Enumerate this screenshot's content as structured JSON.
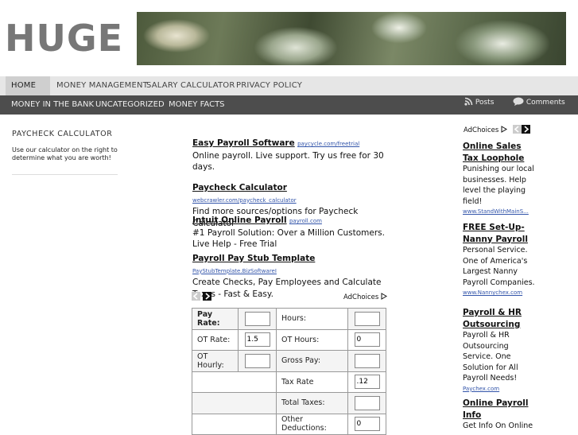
{
  "header": {
    "logo": "HUGE"
  },
  "nav_primary": [
    {
      "label": "HOME"
    },
    {
      "label": "MONEY MANAGEMENT"
    },
    {
      "label": "SALARY CALCULATOR"
    },
    {
      "label": "PRIVACY POLICY"
    }
  ],
  "nav_secondary": [
    {
      "label": "MONEY IN THE BANK"
    },
    {
      "label": "UNCATEGORIZED"
    },
    {
      "label": "MONEY FACTS"
    }
  ],
  "feeds": {
    "posts": "Posts",
    "comments": "Comments"
  },
  "sidebar": {
    "title": "PAYCHECK CALCULATOR",
    "text": "Use our calculator on the right to determine what you are worth!"
  },
  "adchoices_label": "AdChoices",
  "main_ads": [
    {
      "title": "Easy Payroll Software",
      "url": "paycycle.com/freetrial",
      "text": "Online payroll. Live support. Try us free for 30 days."
    },
    {
      "title": "Paycheck Calculator",
      "url": "webcrawler.com/paycheck_calculator",
      "text": "Find more sources/options for Paycheck Calculator"
    },
    {
      "title": "Intuit Online Payroll",
      "url": "payroll.com",
      "text": "#1 Payroll Solution: Over a Million Customers. Live Help - Free Trial"
    },
    {
      "title": "Payroll Pay Stub Template",
      "url": "PayStubTemplate.BizSoftwareI",
      "text": "Create Checks, Pay Employees and Calculate Taxes - Fast & Easy."
    }
  ],
  "calculator": {
    "pay_rate_label": "Pay Rate:",
    "ot_rate_label": "OT Rate:",
    "ot_rate_value": "1.5",
    "ot_hourly_label": "OT Hourly:",
    "hours_label": "Hours:",
    "ot_hours_label": "OT Hours:",
    "ot_hours_value": "0",
    "gross_pay_label": "Gross Pay:",
    "tax_rate_label": "Tax Rate",
    "tax_rate_value": ".12",
    "total_taxes_label": "Total Taxes:",
    "other_deductions_label": "Other Deductions:",
    "other_deductions_value": "0"
  },
  "right_ads": [
    {
      "title": "Online Sales Tax Loophole",
      "text": "Punishing our local businesses. Help level the playing field!",
      "url": "www.StandWithMainS..."
    },
    {
      "title": "FREE Set-Up-Nanny Payroll",
      "text": "Personal Service. One of America's Largest Nanny Payroll Companies.",
      "url": "www.Nannychex.com"
    },
    {
      "title": "Payroll & HR Outsourcing",
      "text": "Payroll & HR Outsourcing Service. One Solution for All Payroll Needs!",
      "url": "Paychex.com"
    },
    {
      "title": "Online Payroll Info",
      "text": "Get Info On Online",
      "url": ""
    }
  ]
}
